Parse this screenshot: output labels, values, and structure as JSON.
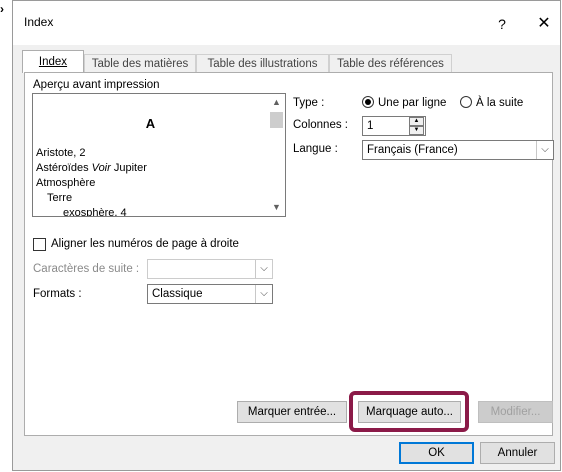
{
  "window": {
    "title": "Index",
    "help": "?",
    "close": "✕"
  },
  "tabs": [
    "Index",
    "Table des matières",
    "Table des illustrations",
    "Table des références"
  ],
  "preview": {
    "label": "Aperçu avant impression",
    "heading": "A",
    "lines": [
      "Aristote, 2",
      "Astéroïdes ",
      "Atmosphère",
      "Terre",
      "exosphère, 4"
    ],
    "italic_word": "Voir",
    "italic_rest": " Jupiter"
  },
  "type": {
    "label": "Type :",
    "option1": "Une par ligne",
    "option2": "À la suite",
    "selected": "Une par ligne"
  },
  "columns": {
    "label": "Colonnes :",
    "value": "1"
  },
  "language": {
    "label": "Langue :",
    "value": "Français (France)"
  },
  "align_right": {
    "label": "Aligner les numéros de page à droite",
    "checked": false
  },
  "tab_leader": {
    "label": "Caractères de suite :",
    "value": ""
  },
  "formats": {
    "label": "Formats :",
    "value": "Classique"
  },
  "buttons": {
    "mark_entry": "Marquer entrée...",
    "automark": "Marquage auto...",
    "modify": "Modifier...",
    "ok": "OK",
    "cancel": "Annuler"
  },
  "icons": {
    "up": "▲",
    "down": "▼",
    "dropdown": "⌵",
    "edge": "›"
  }
}
